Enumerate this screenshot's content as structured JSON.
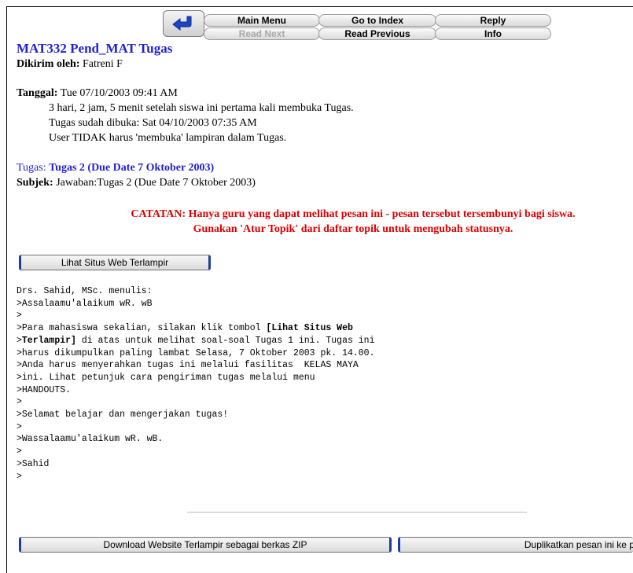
{
  "toolbar": {
    "main_menu": "Main Menu",
    "go_to_index": "Go to Index",
    "reply": "Reply",
    "read_next": "Read Next",
    "read_previous": "Read Previous",
    "info": "Info"
  },
  "header": {
    "title": "MAT332 Pend_MAT Tugas",
    "sender_label": "Dikirim oleh:",
    "sender_value": "Fatreni F"
  },
  "details": {
    "date_label": "Tanggal:",
    "date_value": "Tue 07/10/2003 09:41 AM",
    "line1": "3 hari, 2 jam, 5 menit setelah siswa ini pertama kali membuka Tugas.",
    "line2": "Tugas sudah dibuka: Sat 04/10/2003 07:35 AM",
    "line3": "User TIDAK harus 'membuka' lampiran dalam Tugas."
  },
  "task": {
    "label": "Tugas:",
    "value": "Tugas 2 (Due Date 7 Oktober 2003)",
    "subject_label": "Subjek:",
    "subject_value": "Jawaban:Tugas 2 (Due Date 7 Oktober 2003)"
  },
  "note": {
    "line1": "CATATAN: Hanya guru yang dapat melihat pesan ini - pesan tersebut tersembunyi bagi siswa.",
    "line2": "Gunakan 'Atur Topik' dari daftar topik untuk mengubah statusnya."
  },
  "buttons": {
    "view_site": "Lihat Situs Web Terlampir",
    "download_zip": "Download Website Terlampir sebagai berkas ZIP",
    "duplicate": "Duplikatkan pesan ini ke papan klip"
  },
  "message": {
    "l1": "Drs. Sahid, MSc. menulis:",
    "l2": ">Assalaamu'alaikum wR. wB",
    "l3": ">",
    "l4a": ">Para mahasiswa sekalian, silakan klik tombol ",
    "l4b": "[Lihat Situs Web",
    "l5a": ">",
    "l5b": "Terlampir]",
    "l5c": " di atas untuk melihat soal-soal Tugas 1 ini. Tugas ini",
    "l6": ">harus dikumpulkan paling lambat Selasa, 7 Oktober 2003 pk. 14.00.",
    "l7": ">Anda harus menyerahkan tugas ini melalui fasilitas  KELAS MAYA",
    "l8": ">ini. Lihat petunjuk cara pengiriman tugas melalui menu",
    "l9": ">HANDOUTS.",
    "l10": ">",
    "l11": ">Selamat belajar dan mengerjakan tugas!",
    "l12": ">",
    "l13": ">Wassalaamu'alaikum wR. wB.",
    "l14": ">",
    "l15": ">Sahid",
    "l16": ">"
  },
  "colors": {
    "title_blue": "#1f1fd6",
    "note_red": "#e00000",
    "button_border_blue": "#1a3fa0"
  }
}
